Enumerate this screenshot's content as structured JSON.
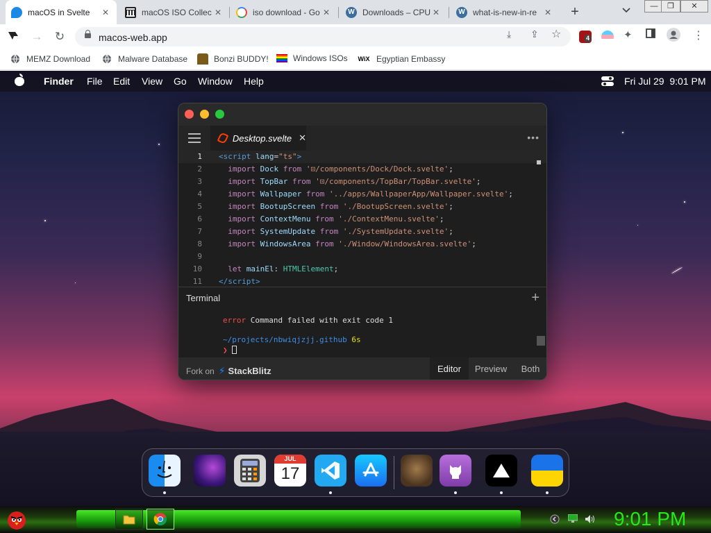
{
  "browser": {
    "tabs": [
      {
        "title": "macOS in Svelte",
        "icon": "svelte-favicon",
        "active": true
      },
      {
        "title": "macOS ISO Collec",
        "icon": "archive-favicon",
        "active": false
      },
      {
        "title": "iso download - Go",
        "icon": "google-favicon",
        "active": false
      },
      {
        "title": "Downloads – CPU",
        "icon": "wordpress-favicon",
        "active": false
      },
      {
        "title": "what-is-new-in-re",
        "icon": "wordpress-favicon",
        "active": false
      }
    ],
    "new_tab": "+",
    "close_glyph": "✕",
    "url": "macos-web.app",
    "extension_badge": "4",
    "bookmarks": [
      {
        "label": "MEMZ Download",
        "icon": "globe-icon"
      },
      {
        "label": "Malware Database",
        "icon": "globe-icon"
      },
      {
        "label": "Bonzi BUDDY!",
        "icon": "bonzi-icon"
      },
      {
        "label": "Windows ISOs",
        "icon": "rainbow-flag-icon"
      },
      {
        "label": "Egyptian Embassy",
        "icon": "wix-icon"
      }
    ],
    "wix_glyph": "WiX"
  },
  "macos": {
    "menubar": {
      "app": "Finder",
      "items": [
        "File",
        "Edit",
        "View",
        "Go",
        "Window",
        "Help"
      ],
      "datetime": "Fri Jul 29  9:01 PM"
    },
    "editor": {
      "tab_name": "Desktop.svelte",
      "more": "•••",
      "code_lines": [
        {
          "n": "1",
          "parts": [
            [
              "tag",
              "<"
            ],
            [
              "tag",
              "script"
            ],
            [
              "txt",
              " "
            ],
            [
              "at",
              "lang"
            ],
            [
              "txt",
              "="
            ],
            [
              "str",
              "\"ts\""
            ],
            [
              "tag",
              ">"
            ]
          ]
        },
        {
          "n": "2",
          "parts": [
            [
              "txt",
              "  "
            ],
            [
              "kw",
              "import"
            ],
            [
              "txt",
              " "
            ],
            [
              "id",
              "Dock"
            ],
            [
              "txt",
              " "
            ],
            [
              "kw",
              "from"
            ],
            [
              "txt",
              " "
            ],
            [
              "str",
              "'⊡/components/Dock/Dock.svelte'"
            ],
            [
              "txt",
              ";"
            ]
          ]
        },
        {
          "n": "3",
          "parts": [
            [
              "txt",
              "  "
            ],
            [
              "kw",
              "import"
            ],
            [
              "txt",
              " "
            ],
            [
              "id",
              "TopBar"
            ],
            [
              "txt",
              " "
            ],
            [
              "kw",
              "from"
            ],
            [
              "txt",
              " "
            ],
            [
              "str",
              "'⊡/components/TopBar/TopBar.svelte'"
            ],
            [
              "txt",
              ";"
            ]
          ]
        },
        {
          "n": "4",
          "parts": [
            [
              "txt",
              "  "
            ],
            [
              "kw",
              "import"
            ],
            [
              "txt",
              " "
            ],
            [
              "id",
              "Wallpaper"
            ],
            [
              "txt",
              " "
            ],
            [
              "kw",
              "from"
            ],
            [
              "txt",
              " "
            ],
            [
              "str",
              "'../apps/WallpaperApp/Wallpaper.svelte'"
            ],
            [
              "txt",
              ";"
            ]
          ]
        },
        {
          "n": "5",
          "parts": [
            [
              "txt",
              "  "
            ],
            [
              "kw",
              "import"
            ],
            [
              "txt",
              " "
            ],
            [
              "id",
              "BootupScreen"
            ],
            [
              "txt",
              " "
            ],
            [
              "kw",
              "from"
            ],
            [
              "txt",
              " "
            ],
            [
              "str",
              "'./BootupScreen.svelte'"
            ],
            [
              "txt",
              ";"
            ]
          ]
        },
        {
          "n": "6",
          "parts": [
            [
              "txt",
              "  "
            ],
            [
              "kw",
              "import"
            ],
            [
              "txt",
              " "
            ],
            [
              "id",
              "ContextMenu"
            ],
            [
              "txt",
              " "
            ],
            [
              "kw",
              "from"
            ],
            [
              "txt",
              " "
            ],
            [
              "str",
              "'./ContextMenu.svelte'"
            ],
            [
              "txt",
              ";"
            ]
          ]
        },
        {
          "n": "7",
          "parts": [
            [
              "txt",
              "  "
            ],
            [
              "kw",
              "import"
            ],
            [
              "txt",
              " "
            ],
            [
              "id",
              "SystemUpdate"
            ],
            [
              "txt",
              " "
            ],
            [
              "kw",
              "from"
            ],
            [
              "txt",
              " "
            ],
            [
              "str",
              "'./SystemUpdate.svelte'"
            ],
            [
              "txt",
              ";"
            ]
          ]
        },
        {
          "n": "8",
          "parts": [
            [
              "txt",
              "  "
            ],
            [
              "kw",
              "import"
            ],
            [
              "txt",
              " "
            ],
            [
              "id",
              "WindowsArea"
            ],
            [
              "txt",
              " "
            ],
            [
              "kw",
              "from"
            ],
            [
              "txt",
              " "
            ],
            [
              "str",
              "'./Window/WindowsArea.svelte'"
            ],
            [
              "txt",
              ";"
            ]
          ]
        },
        {
          "n": "9",
          "parts": []
        },
        {
          "n": "10",
          "parts": [
            [
              "txt",
              "  "
            ],
            [
              "kw",
              "let"
            ],
            [
              "txt",
              " "
            ],
            [
              "id",
              "mainEl"
            ],
            [
              "txt",
              ": "
            ],
            [
              "ty",
              "HTMLElement"
            ],
            [
              "txt",
              ";"
            ]
          ]
        },
        {
          "n": "11",
          "parts": [
            [
              "tag",
              "</"
            ],
            [
              "tag",
              "script"
            ],
            [
              "tag",
              ">"
            ]
          ]
        }
      ],
      "terminal": {
        "title": "Terminal",
        "plus": "+",
        "error_word": "error",
        "error_msg": " Command failed with exit code 1",
        "path": "~/projects/nbwiqjzjj.github",
        "time": " 6s",
        "prompt": "❯"
      },
      "footer": {
        "fork_on": "Fork on",
        "brand": "StackBlitz",
        "bolt": "⚡",
        "views": [
          "Editor",
          "Preview",
          "Both"
        ],
        "active_view": "Editor"
      }
    },
    "dock": {
      "items": [
        "finder-icon",
        "wallpapers-icon",
        "calculator-icon",
        "calendar-icon",
        "vscode-icon",
        "app-store-icon",
        "cat-photo-icon",
        "github-icon",
        "vercel-icon",
        "ukraine-flag-icon"
      ],
      "calendar": {
        "month": "JUL",
        "day": "17"
      }
    }
  },
  "taskbar": {
    "clock": "9:01 PM"
  },
  "colors": {
    "accent_green": "#26e81a",
    "svelte_orange": "#ff3e00",
    "stackblitz_blue": "#1389fd"
  }
}
